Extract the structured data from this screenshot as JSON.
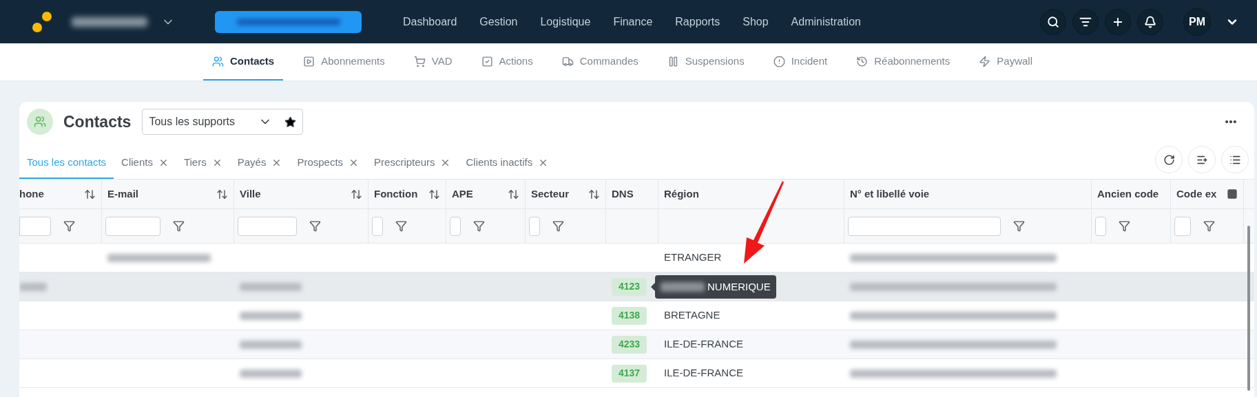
{
  "topbar": {
    "nav": [
      {
        "label": "Dashboard"
      },
      {
        "label": "Gestion"
      },
      {
        "label": "Logistique"
      },
      {
        "label": "Finance"
      },
      {
        "label": "Rapports"
      },
      {
        "label": "Shop"
      },
      {
        "label": "Administration"
      }
    ],
    "avatar": "PM"
  },
  "subnav": [
    {
      "label": "Contacts",
      "selected": true
    },
    {
      "label": "Abonnements",
      "selected": false
    },
    {
      "label": "VAD",
      "selected": false
    },
    {
      "label": "Actions",
      "selected": false
    },
    {
      "label": "Commandes",
      "selected": false
    },
    {
      "label": "Suspensions",
      "selected": false
    },
    {
      "label": "Incident",
      "selected": false
    },
    {
      "label": "Réabonnements",
      "selected": false
    },
    {
      "label": "Paywall",
      "selected": false
    }
  ],
  "page": {
    "title": "Contacts",
    "support_select": "Tous les supports"
  },
  "filter_tabs": [
    {
      "label": "Tous les contacts",
      "selected": true,
      "closable": false
    },
    {
      "label": "Clients",
      "selected": false,
      "closable": true
    },
    {
      "label": "Tiers",
      "selected": false,
      "closable": true
    },
    {
      "label": "Payés",
      "selected": false,
      "closable": true
    },
    {
      "label": "Prospects",
      "selected": false,
      "closable": true
    },
    {
      "label": "Prescripteurs",
      "selected": false,
      "closable": true
    },
    {
      "label": "Clients inactifs",
      "selected": false,
      "closable": true
    }
  ],
  "table": {
    "columns": [
      {
        "label": "hone",
        "sortable": true,
        "filter": true
      },
      {
        "label": "E-mail",
        "sortable": true,
        "filter": true
      },
      {
        "label": "Ville",
        "sortable": true,
        "filter": true
      },
      {
        "label": "Fonction",
        "sortable": true,
        "filter": true
      },
      {
        "label": "APE",
        "sortable": true,
        "filter": true
      },
      {
        "label": "Secteur",
        "sortable": true,
        "filter": true
      },
      {
        "label": "DNS",
        "sortable": false,
        "filter": false
      },
      {
        "label": "Région",
        "sortable": false,
        "filter": false
      },
      {
        "label": "N° et libellé voie",
        "sortable": false,
        "filter": true
      },
      {
        "label": "Ancien code",
        "sortable": false,
        "filter": true
      },
      {
        "label": "Code ex",
        "sortable": false,
        "filter": true
      }
    ],
    "rows": [
      {
        "selected": false,
        "region": "ETRANGER",
        "phone_hidden": false,
        "email_hidden": true,
        "ville_hidden": false,
        "address_hidden": true
      },
      {
        "selected": true,
        "dns": "4123",
        "phone_hidden": true,
        "email_hidden": false,
        "ville_hidden": true,
        "address_hidden": true,
        "tooltip": {
          "text": "NUMERIQUE"
        }
      },
      {
        "selected": false,
        "dns": "4138",
        "region": "BRETAGNE",
        "phone_hidden": false,
        "email_hidden": false,
        "ville_hidden": true,
        "address_hidden": true
      },
      {
        "selected": false,
        "dns": "4233",
        "region": "ILE-DE-FRANCE",
        "phone_hidden": false,
        "email_hidden": false,
        "ville_hidden": true,
        "address_hidden": true
      },
      {
        "selected": false,
        "dns": "4137",
        "region": "ILE-DE-FRANCE",
        "phone_hidden": false,
        "email_hidden": false,
        "ville_hidden": true,
        "address_hidden": true
      }
    ]
  }
}
